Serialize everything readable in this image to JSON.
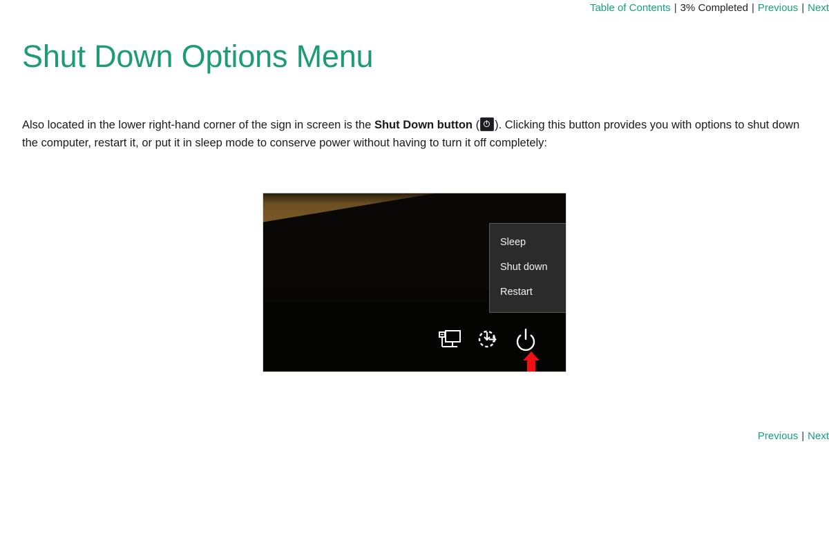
{
  "top_nav": {
    "toc_label": "Table of Contents",
    "separator": "|",
    "progress_label": "3% Completed",
    "previous_label": "Previous",
    "next_label": "Next"
  },
  "page_title": "Shut Down Options Menu",
  "body": {
    "text_part1": "Also located in the lower right-hand corner of the sign in screen is the ",
    "bold_phrase": "Shut Down button",
    "text_open_paren": " (",
    "power_icon_name": "power-icon",
    "text_part2": "). Clicking this button provides you with options to shut down the computer, restart it, or put it in sleep mode to conserve power without having to turn it off completely:"
  },
  "screenshot": {
    "caption_alt": "Windows sign in screen shut down options menu",
    "menu": {
      "items": [
        {
          "label": "Sleep"
        },
        {
          "label": "Shut down"
        },
        {
          "label": "Restart"
        }
      ]
    },
    "taskbar_icons": [
      {
        "name": "network-icon"
      },
      {
        "name": "ease-of-access-icon"
      },
      {
        "name": "power-icon"
      }
    ],
    "annotation": {
      "name": "red-arrow-annotation",
      "color": "#ee1111"
    },
    "colors": {
      "menu_background": "#2b2b2b",
      "menu_border": "#5a5a5a",
      "menu_text": "#f2f2f2",
      "sky": "#7d5c27",
      "foreground": "#070605"
    }
  },
  "bottom_nav": {
    "previous_label": "Previous",
    "separator": "|",
    "next_label": "Next"
  },
  "theme": {
    "link_color": "#17a07e",
    "title_color": "#1d9c74",
    "text_color": "#1a1a1a"
  }
}
